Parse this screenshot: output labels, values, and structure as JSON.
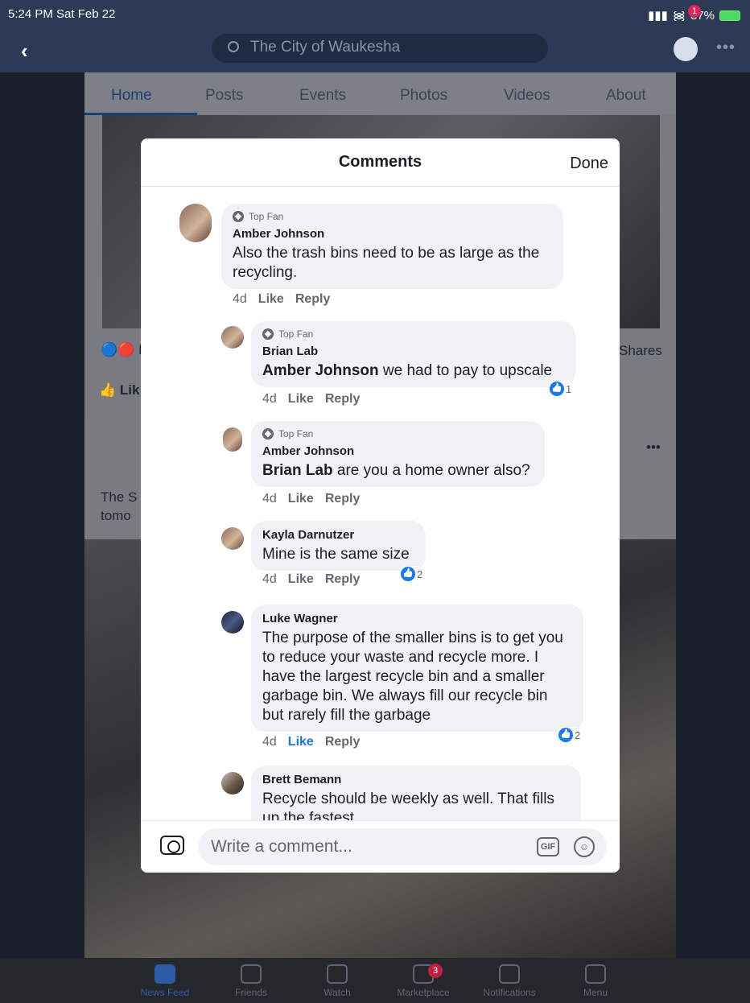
{
  "status_bar": {
    "time": "5:24 PM  Sat Feb 22",
    "signal": "▮▮▮",
    "wifi": "᯼",
    "battery": "87%"
  },
  "nav": {
    "search_text": "The City of Waukesha",
    "messenger_badge": "1",
    "more": "•••"
  },
  "page": {
    "tabs": [
      "Home",
      "Posts",
      "Events",
      "Photos",
      "Videos",
      "About"
    ],
    "active_tab": "Home",
    "reactions_fragment": "E",
    "shares_fragment": "Shares",
    "like_fragment": "Lik",
    "post_text_line1": "The S",
    "post_text_line2": "tomo",
    "post_more": "•••"
  },
  "modal": {
    "title": "Comments",
    "done_label": "Done",
    "comments": [
      {
        "badge": "Top Fan",
        "name": "Amber Johnson",
        "mention": "",
        "text": "Also the trash bins need to be as large as the recycling.",
        "age": "4d",
        "like": "Like",
        "reply": "Reply",
        "reactions": ""
      },
      {
        "badge": "Top Fan",
        "name": "Brian Lab",
        "mention": "Amber Johnson",
        "text": " we had to pay to upscale",
        "age": "4d",
        "like": "Like",
        "reply": "Reply",
        "reactions": "1"
      },
      {
        "badge": "Top Fan",
        "name": "Amber Johnson",
        "mention": "Brian Lab",
        "text": " are you a home owner also?",
        "age": "4d",
        "like": "Like",
        "reply": "Reply",
        "reactions": ""
      },
      {
        "badge": "",
        "name": "Kayla Darnutzer",
        "mention": "",
        "text": "Mine is the same size",
        "age": "4d",
        "like": "Like",
        "reply": "Reply",
        "reactions": "2"
      },
      {
        "badge": "",
        "name": "Luke Wagner",
        "mention": "",
        "text": "The purpose of the smaller bins is to get you to reduce your waste and recycle more. I have the largest recycle bin and a smaller garbage bin.  We always fill our recycle bin but rarely fill the garbage",
        "age": "4d",
        "like": "Like",
        "reply": "Reply",
        "reactions": "2"
      },
      {
        "badge": "",
        "name": "Brett Bemann",
        "mention": "",
        "text": "Recycle should be weekly as well.  That fills up the fastest",
        "age": "",
        "like": "",
        "reply": "",
        "reactions": ""
      }
    ],
    "composer": {
      "placeholder": "Write a comment...",
      "gif_label": "GIF",
      "emoji": "☺"
    }
  },
  "tabbar": {
    "items": [
      "News Feed",
      "Friends",
      "Watch",
      "Marketplace",
      "Notifications",
      "Menu"
    ],
    "active": "News Feed",
    "marketplace_badge": "3"
  },
  "colors": {
    "facebook_blue": "#1877f2",
    "nav_bg": "#2c3a55",
    "bubble_bg": "#f0f2f5"
  }
}
